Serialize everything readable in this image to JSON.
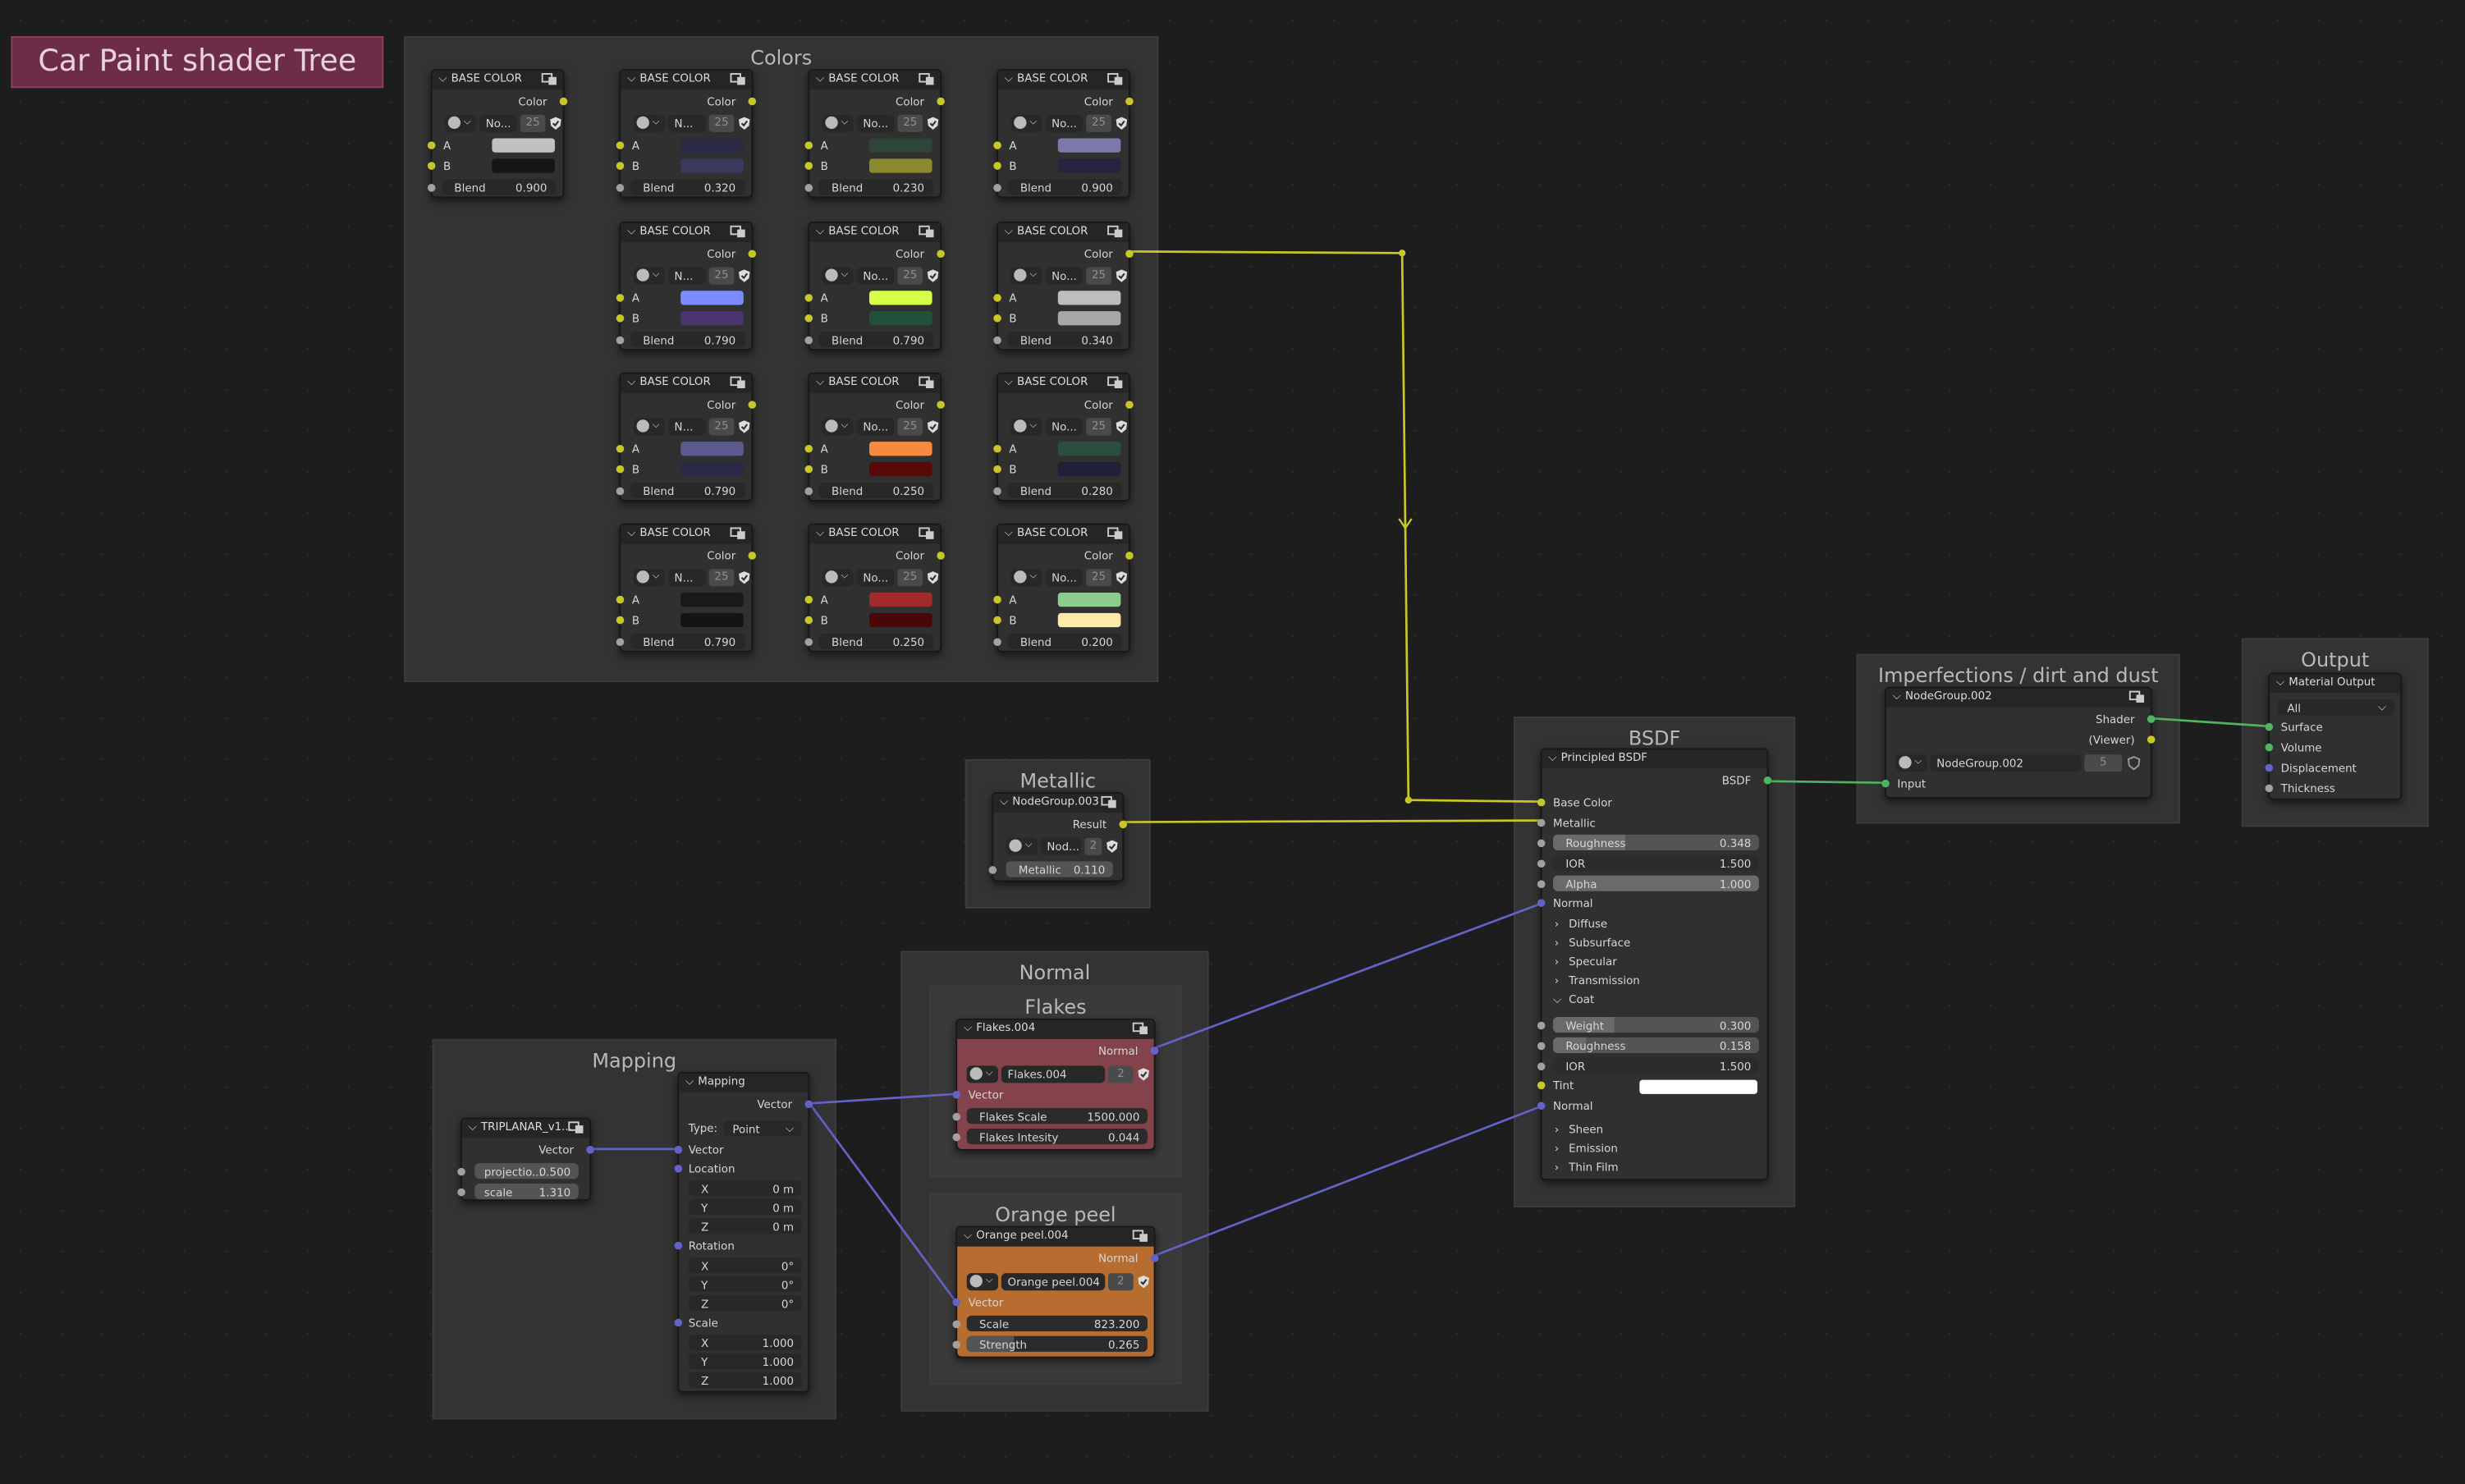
{
  "title": "Car Paint shader Tree",
  "frames": {
    "colors": "Colors",
    "metallic": "Metallic",
    "normal": "Normal",
    "flakes": "Flakes",
    "orange_peel": "Orange peel",
    "mapping": "Mapping",
    "bsdf": "BSDF",
    "imperfections": "Imperfections / dirt and dust",
    "output": "Output"
  },
  "base_color_node": {
    "title": "BASE COLOR",
    "out_label": "Color",
    "a_label": "A",
    "b_label": "B",
    "blend_label": "Blend",
    "user_count": "25"
  },
  "base_colors": [
    {
      "ds": "No...",
      "a": "#c1c1c1",
      "b": "#151515",
      "blend": "0.900"
    },
    {
      "ds": "N...",
      "a": "#2a2a46",
      "b": "#3a3a5e",
      "blend": "0.320"
    },
    {
      "ds": "No...",
      "a": "#2e4538",
      "b": "#8c8a30",
      "blend": "0.230"
    },
    {
      "ds": "No...",
      "a": "#7b79ac",
      "b": "#26243e",
      "blend": "0.900"
    },
    {
      "ds": "N...",
      "a": "#7a8cff",
      "b": "#4a3570",
      "blend": "0.790"
    },
    {
      "ds": "No...",
      "a": "#d7ff47",
      "b": "#1f5238",
      "blend": "0.790"
    },
    {
      "ds": "No...",
      "a": "#bdbdbd",
      "b": "#a8a8a8",
      "blend": "0.340"
    },
    {
      "ds": "N...",
      "a": "#5b5b8e",
      "b": "#2a2a46",
      "blend": "0.790"
    },
    {
      "ds": "No...",
      "a": "#f68a40",
      "b": "#5a0808",
      "blend": "0.250"
    },
    {
      "ds": "No...",
      "a": "#2d4d3d",
      "b": "#202038",
      "blend": "0.280"
    },
    {
      "ds": "N...",
      "a": "#191919",
      "b": "#141414",
      "blend": "0.790"
    },
    {
      "ds": "No...",
      "a": "#a12a2a",
      "b": "#4a0707",
      "blend": "0.250"
    },
    {
      "ds": "No...",
      "a": "#8ccc8c",
      "b": "#fdeba8",
      "blend": "0.200"
    }
  ],
  "metallic_node": {
    "title": "NodeGroup.003",
    "out": "Result",
    "ds": "Nod...",
    "count": "2",
    "field": "Metallic",
    "value": "0.110"
  },
  "flakes_node": {
    "title": "Flakes.004",
    "out": "Normal",
    "ds": "Flakes.004",
    "count": "2",
    "in": "Vector",
    "scale_label": "Flakes Scale",
    "scale": "1500.000",
    "int_label": "Flakes Intesity",
    "int": "0.044"
  },
  "orange_node": {
    "title": "Orange peel.004",
    "out": "Normal",
    "ds": "Orange peel.004",
    "count": "2",
    "in": "Vector",
    "scale_label": "Scale",
    "scale": "823.200",
    "str_label": "Strength",
    "str": "0.265"
  },
  "triplanar_node": {
    "title": "TRIPLANAR_v1...",
    "out": "Vector",
    "p_label": "projectio...",
    "p": "0.500",
    "s_label": "scale",
    "s": "1.310"
  },
  "mapping_node": {
    "title": "Mapping",
    "out": "Vector",
    "type_label": "Type:",
    "type": "Point",
    "vector": "Vector",
    "location": "Location",
    "rotation": "Rotation",
    "scale": "Scale",
    "loc": [
      {
        "a": "X",
        "v": "0 m"
      },
      {
        "a": "Y",
        "v": "0 m"
      },
      {
        "a": "Z",
        "v": "0 m"
      }
    ],
    "rot": [
      {
        "a": "X",
        "v": "0°"
      },
      {
        "a": "Y",
        "v": "0°"
      },
      {
        "a": "Z",
        "v": "0°"
      }
    ],
    "scl": [
      {
        "a": "X",
        "v": "1.000"
      },
      {
        "a": "Y",
        "v": "1.000"
      },
      {
        "a": "Z",
        "v": "1.000"
      }
    ]
  },
  "bsdf_node": {
    "title": "Principled BSDF",
    "out": "BSDF",
    "base_color": "Base Color",
    "metallic": "Metallic",
    "roughness_label": "Roughness",
    "roughness": "0.348",
    "ior_label": "IOR",
    "ior": "1.500",
    "alpha_label": "Alpha",
    "alpha": "1.000",
    "normal": "Normal",
    "panels": [
      "Diffuse",
      "Subsurface",
      "Specular",
      "Transmission"
    ],
    "coat": "Coat",
    "weight_label": "Weight",
    "weight": "0.300",
    "coat_rough_label": "Roughness",
    "coat_rough": "0.158",
    "coat_ior_label": "IOR",
    "coat_ior": "1.500",
    "tint": "Tint",
    "coat_normal": "Normal",
    "panels2": [
      "Sheen",
      "Emission",
      "Thin Film"
    ]
  },
  "imperf_node": {
    "title": "NodeGroup.002",
    "shader": "Shader",
    "viewer": "(Viewer)",
    "input": "Input",
    "ds": "NodeGroup.002",
    "count": "5"
  },
  "output_node": {
    "title": "Material Output",
    "target": "All",
    "surface": "Surface",
    "volume": "Volume",
    "displacement": "Displacement",
    "thickness": "Thickness"
  },
  "colors": {
    "socket_color": "#c7c729",
    "socket_float": "#a1a1a1",
    "socket_vector": "#6363c7",
    "socket_shader": "#4fb35f",
    "flakes_body": "#84424a",
    "orange_body": "#b66d2f",
    "title_card": "#6d2c48"
  }
}
